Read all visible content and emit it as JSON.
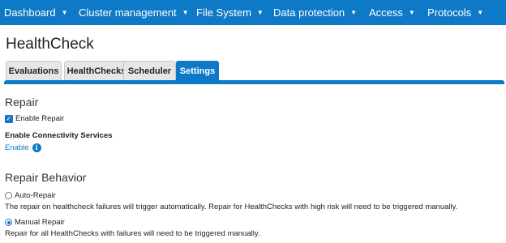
{
  "nav": {
    "items": [
      {
        "label": "Dashboard"
      },
      {
        "label": "Cluster management"
      },
      {
        "label": "File System"
      },
      {
        "label": "Data protection"
      },
      {
        "label": "Access"
      },
      {
        "label": "Protocols"
      }
    ],
    "caret_icon": "caret-down-icon",
    "background": "#0e79c6"
  },
  "page": {
    "title": "HealthCheck"
  },
  "tabs": [
    {
      "label": "Evaluations",
      "active": false
    },
    {
      "label": "HealthChecks",
      "active": false
    },
    {
      "label": "Scheduler",
      "active": false
    },
    {
      "label": "Settings",
      "active": true
    }
  ],
  "repair": {
    "section_title": "Repair",
    "enable_repair_label": "Enable Repair",
    "enable_repair_checked": true,
    "connectivity_label": "Enable Connectivity Services",
    "enable_link": "Enable",
    "info_icon": "info-icon"
  },
  "behavior": {
    "section_title": "Repair Behavior",
    "auto_repair_label": "Auto-Repair",
    "auto_repair_selected": false,
    "auto_repair_desc": "The repair on healthcheck failures will trigger automatically. Repair for HealthChecks with high risk will need to be triggered manually.",
    "manual_repair_label": "Manual Repair",
    "manual_repair_selected": true,
    "manual_repair_desc": "Repair for all HealthChecks with failures will need to be triggered manually."
  }
}
